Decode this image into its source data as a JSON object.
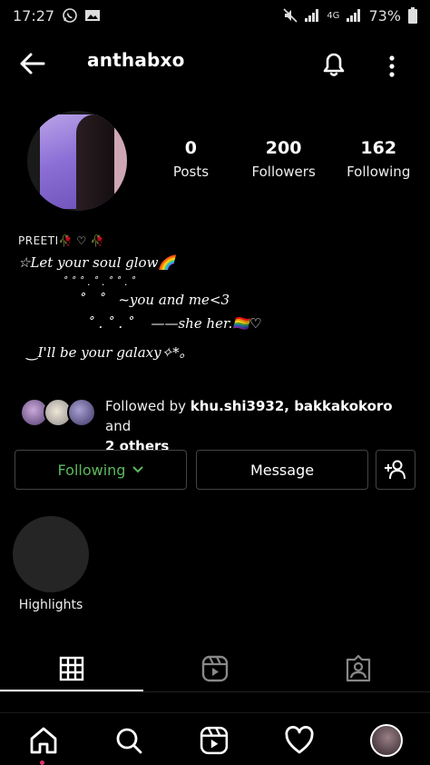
{
  "status_bar": {
    "time": "17:27",
    "network": "4G",
    "battery": "73%",
    "icons": [
      "whatsapp-icon",
      "gallery-icon",
      "mute-icon",
      "signal-icon",
      "battery-icon"
    ]
  },
  "header": {
    "username": "anthabxo",
    "icons": [
      "back-arrow-icon",
      "bell-icon",
      "more-vertical-icon"
    ]
  },
  "profile": {
    "stats": [
      {
        "count": "0",
        "label": "Posts"
      },
      {
        "count": "200",
        "label": "Followers"
      },
      {
        "count": "162",
        "label": "Following"
      }
    ]
  },
  "bio": {
    "name": "PREETI🥀 ♡ 🥀",
    "lines": [
      "☆Let your soul glow🌈",
      "              ˚ ˚ ˚ . ˚ . ˚ ˚ . ˚",
      "              ˚   ˚   ~you and me<3",
      "                ˚ . ˚ . ˚    ——she her.🏳️‍🌈♡",
      "  ‿I'll be your galaxy✧*｡"
    ]
  },
  "followed_by": {
    "prefix": "Followed by ",
    "names": "khu.shi3932, bakkakokoro",
    "connector": " and",
    "others": "2 others"
  },
  "actions": {
    "following_label": "Following",
    "message_label": "Message",
    "following_color": "#5cb85c"
  },
  "highlights": {
    "label": "Highlights"
  },
  "tabs": [
    "grid-icon",
    "reels-icon",
    "tagged-icon"
  ],
  "bottom_nav": [
    "home-icon",
    "search-icon",
    "reels-icon",
    "heart-icon",
    "profile-avatar"
  ]
}
